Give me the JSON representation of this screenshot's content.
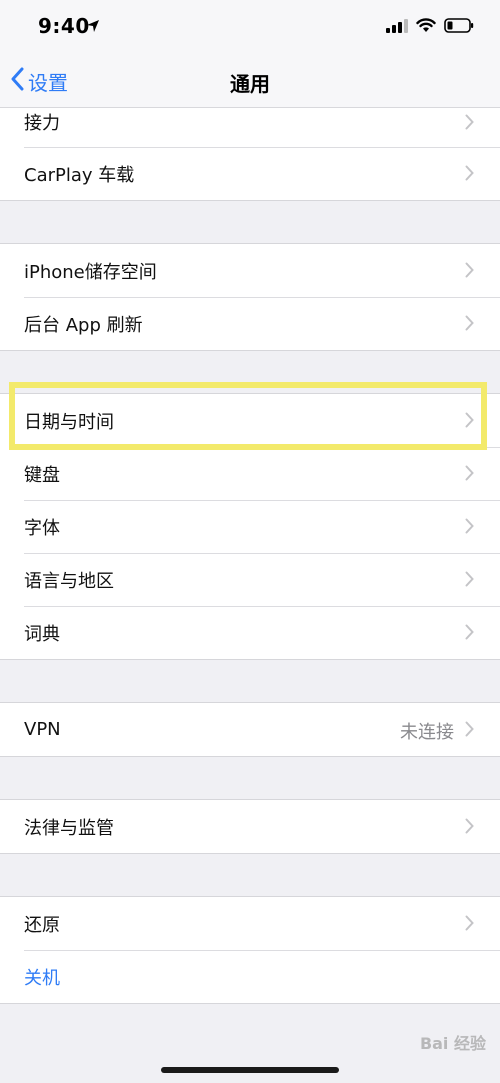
{
  "status_bar": {
    "time": "9:40"
  },
  "nav": {
    "back_label": "设置",
    "title": "通用"
  },
  "groups": [
    {
      "rows": [
        {
          "label": "接力"
        },
        {
          "label": "CarPlay 车载"
        }
      ]
    },
    {
      "rows": [
        {
          "label": "iPhone储存空间"
        },
        {
          "label": "后台 App 刷新"
        }
      ]
    },
    {
      "rows": [
        {
          "label": "日期与时间"
        },
        {
          "label": "键盘"
        },
        {
          "label": "字体"
        },
        {
          "label": "语言与地区"
        },
        {
          "label": "词典"
        }
      ]
    },
    {
      "rows": [
        {
          "label": "VPN",
          "value": "未连接"
        }
      ]
    },
    {
      "rows": [
        {
          "label": "法律与监管"
        }
      ]
    },
    {
      "rows": [
        {
          "label": "还原"
        },
        {
          "label": "关机"
        }
      ]
    }
  ],
  "watermark": "Bai 经验",
  "colors": {
    "accent": "#2f7cf6",
    "highlight": "#f3ea6b",
    "background": "#f0f0f4"
  }
}
